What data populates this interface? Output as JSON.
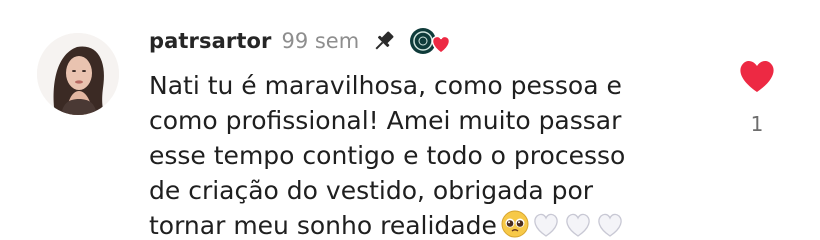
{
  "comment": {
    "username": "patrsartor",
    "timestamp": "99 sem",
    "text": "Nati tu é maravilhosa, como pessoa e\ncomo profissional! Amei muito passar\nesse tempo contigo e todo o processo\nde criação do vestido, obrigada por\ntornar meu sonho realidade",
    "emojis": [
      "pleading-face",
      "white-heart",
      "white-heart",
      "white-heart"
    ],
    "like_count": "1",
    "icons": {
      "pin": "pin-icon",
      "creator_like": "creator-liked-heart-icon",
      "like": "heart-icon"
    },
    "colors": {
      "like_heart": "#ed2943",
      "timestamp": "#8e8e8e",
      "creator_avatar": "#0f3b3a"
    }
  }
}
